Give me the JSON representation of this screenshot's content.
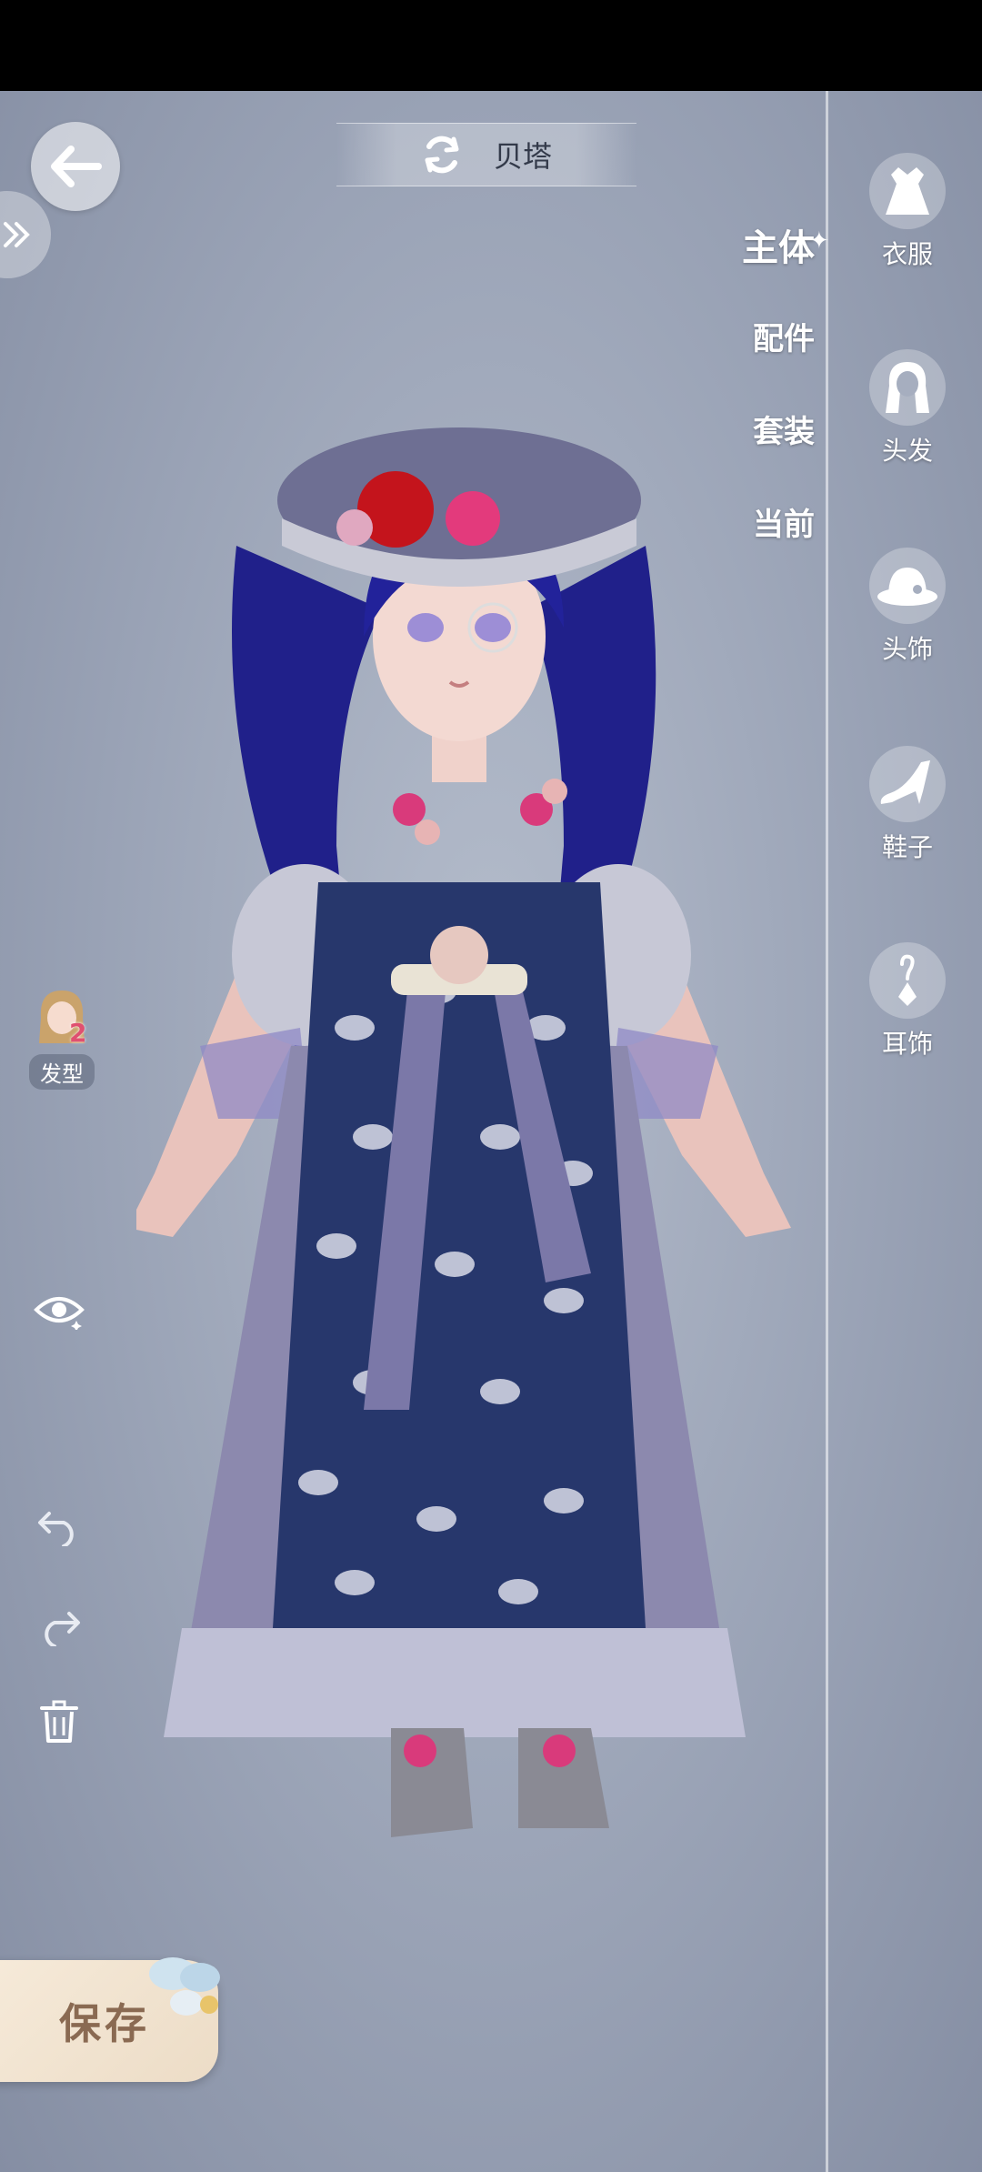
{
  "header": {
    "title": "贝塔",
    "refresh_icon": "refresh-icon"
  },
  "tabs": [
    {
      "label": "主体",
      "active": true
    },
    {
      "label": "配件",
      "active": false
    },
    {
      "label": "套装",
      "active": false
    },
    {
      "label": "当前",
      "active": false
    }
  ],
  "nav": {
    "items": [
      {
        "label": "衣服",
        "icon": "dress-icon"
      },
      {
        "label": "头发",
        "icon": "hair-icon"
      },
      {
        "label": "头饰",
        "icon": "hat-icon"
      },
      {
        "label": "鞋子",
        "icon": "shoe-icon"
      },
      {
        "label": "耳饰",
        "icon": "earring-icon"
      }
    ]
  },
  "left_tools": {
    "hair_style": {
      "label": "发型",
      "badge": "2"
    }
  },
  "save": {
    "label": "保存"
  },
  "colors": {
    "accent": "#ffffff",
    "save_bg": "#f3e6d4",
    "save_text": "#8a6a52",
    "dress": "#27376c"
  }
}
